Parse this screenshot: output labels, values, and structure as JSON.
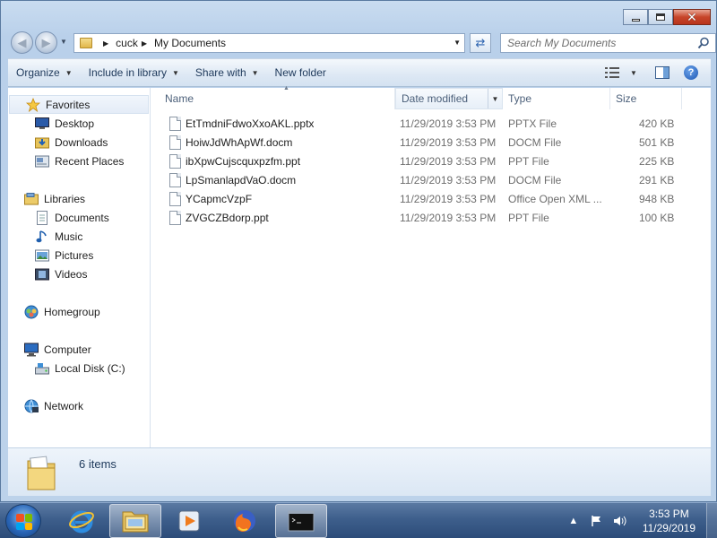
{
  "address": {
    "breadcrumbs": [
      "cuck",
      "My Documents"
    ],
    "search_placeholder": "Search My Documents"
  },
  "toolbar": {
    "organize": "Organize",
    "include_in_library": "Include in library",
    "share_with": "Share with",
    "new_folder": "New folder"
  },
  "sidebar": {
    "favorites": "Favorites",
    "favorites_items": [
      "Desktop",
      "Downloads",
      "Recent Places"
    ],
    "libraries": "Libraries",
    "libraries_items": [
      "Documents",
      "Music",
      "Pictures",
      "Videos"
    ],
    "homegroup": "Homegroup",
    "computer": "Computer",
    "computer_items": [
      "Local Disk (C:)"
    ],
    "network": "Network"
  },
  "columns": {
    "name": "Name",
    "date_modified": "Date modified",
    "type": "Type",
    "size": "Size"
  },
  "files": [
    {
      "name": "EtTmdniFdwoXxoAKL.pptx",
      "date": "11/29/2019 3:53 PM",
      "type": "PPTX File",
      "size": "420 KB"
    },
    {
      "name": "HoiwJdWhApWf.docm",
      "date": "11/29/2019 3:53 PM",
      "type": "DOCM File",
      "size": "501 KB"
    },
    {
      "name": "ibXpwCujscquxpzfm.ppt",
      "date": "11/29/2019 3:53 PM",
      "type": "PPT File",
      "size": "225 KB"
    },
    {
      "name": "LpSmanlapdVaO.docm",
      "date": "11/29/2019 3:53 PM",
      "type": "DOCM File",
      "size": "291 KB"
    },
    {
      "name": "YCapmcVzpF",
      "date": "11/29/2019 3:53 PM",
      "type": "Office Open XML ...",
      "size": "948 KB"
    },
    {
      "name": "ZVGCZBdorp.ppt",
      "date": "11/29/2019 3:53 PM",
      "type": "PPT File",
      "size": "100 KB"
    }
  ],
  "details": {
    "item_count": "6 items"
  },
  "taskbar": {
    "time": "3:53 PM",
    "date": "11/29/2019"
  }
}
